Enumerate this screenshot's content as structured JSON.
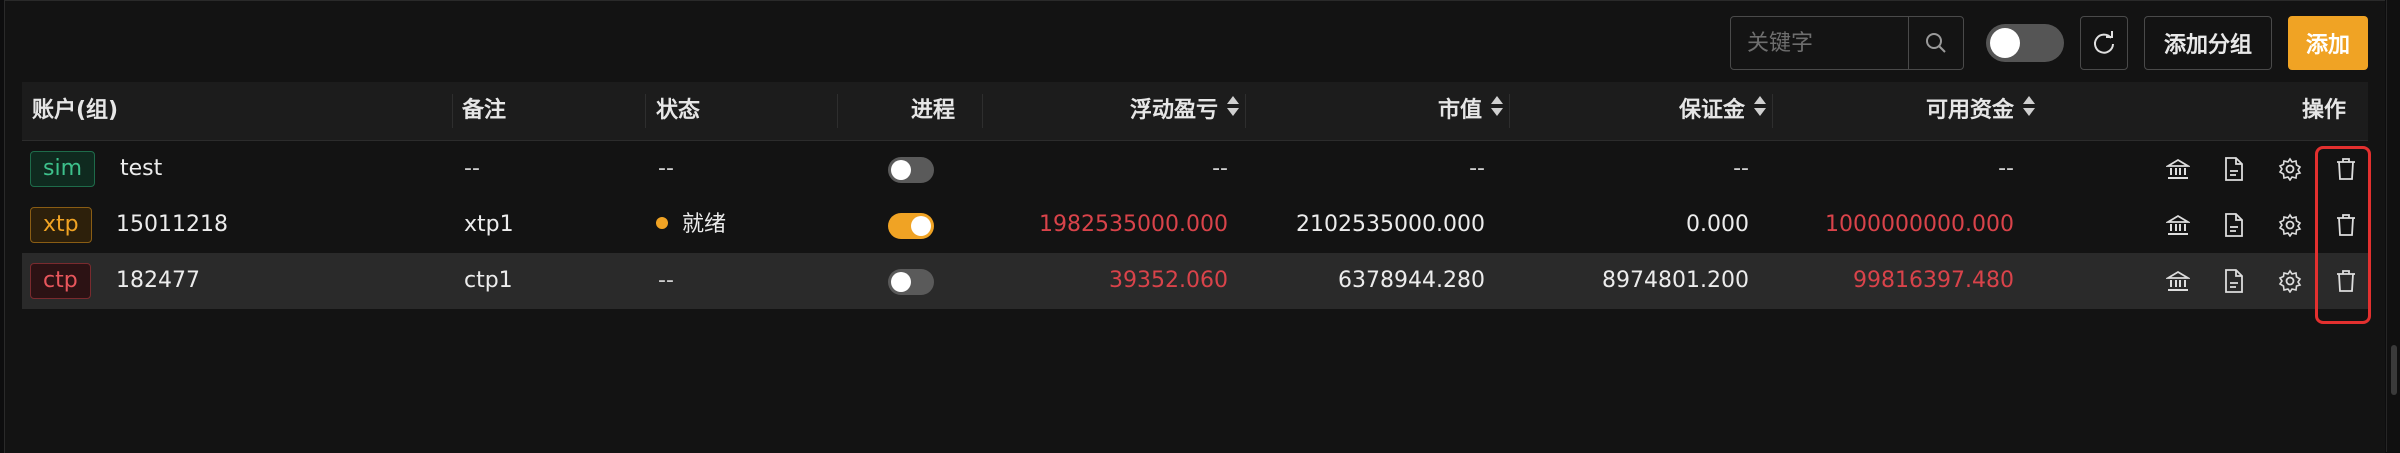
{
  "toolbar": {
    "search_placeholder": "关键字",
    "group_label": "添加分组",
    "add_label": "添加"
  },
  "table": {
    "columns": [
      "账户(组)",
      "备注",
      "状态",
      "进程",
      "浮动盈亏",
      "市值",
      "保证金",
      "可用资金",
      "操作"
    ],
    "rows": [
      {
        "tag": "sim",
        "account": "test",
        "note": "--",
        "status": "--",
        "process_on": false,
        "float_pnl": "--",
        "market_value": "--",
        "margin": "--",
        "available": "--"
      },
      {
        "tag": "xtp",
        "account": "15011218",
        "note": "xtp1",
        "status": "就绪",
        "process_on": true,
        "float_pnl": "1982535000.000",
        "market_value": "2102535000.000",
        "margin": "0.000",
        "available": "1000000000.000"
      },
      {
        "tag": "ctp",
        "account": "182477",
        "note": "ctp1",
        "status": "--",
        "process_on": false,
        "float_pnl": "39352.060",
        "market_value": "6378944.280",
        "margin": "8974801.200",
        "available": "99816397.480"
      }
    ]
  },
  "colors": {
    "accent": "#f0a324",
    "negative": "#d9434a",
    "highlight": "#e3302f"
  }
}
